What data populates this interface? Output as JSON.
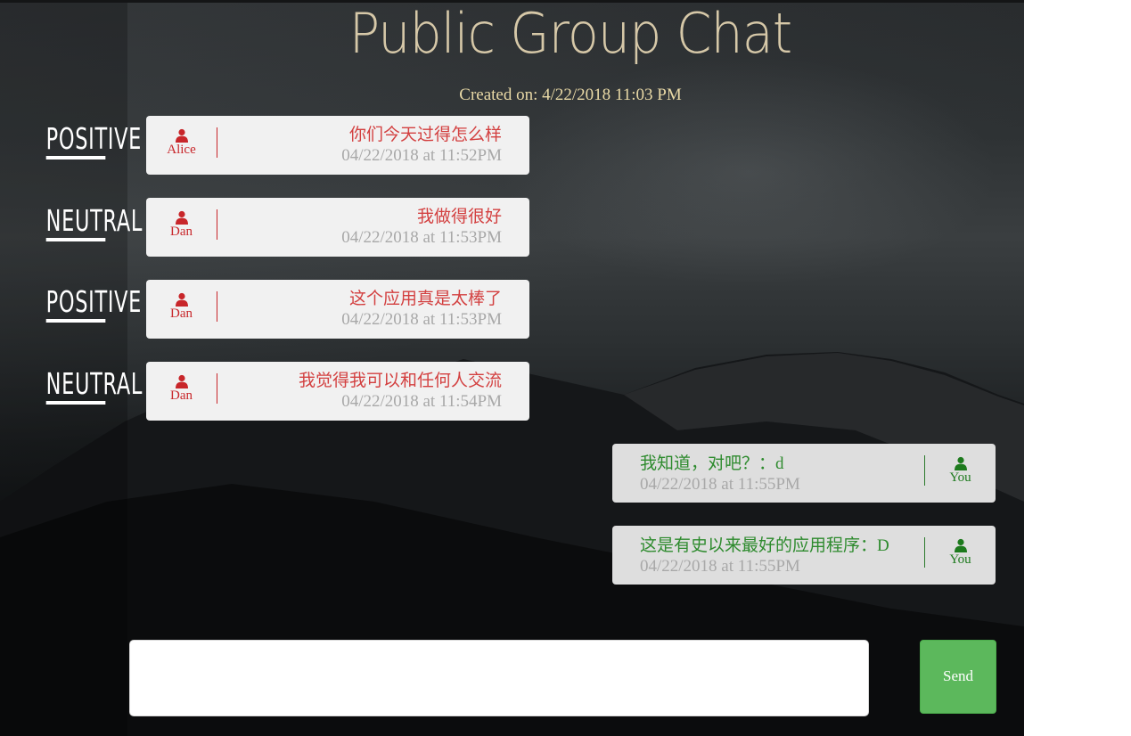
{
  "chat": {
    "title": "Public Group Chat",
    "created": "Created on: 4/22/2018 11:03 PM"
  },
  "sentiments": [
    "POSITIVE",
    "NEUTRAL",
    "POSITIVE",
    "NEUTRAL"
  ],
  "messages": [
    {
      "author": "Alice",
      "text": "你们今天过得怎么样",
      "time": "04/22/2018 at 11:52PM",
      "side": "in"
    },
    {
      "author": "Dan",
      "text": "我做得很好",
      "time": "04/22/2018 at 11:53PM",
      "side": "in"
    },
    {
      "author": "Dan",
      "text": "这个应用真是太棒了",
      "time": "04/22/2018 at 11:53PM",
      "side": "in"
    },
    {
      "author": "Dan",
      "text": "我觉得我可以和任何人交流",
      "time": "04/22/2018 at 11:54PM",
      "side": "in"
    },
    {
      "author": "You",
      "text": "我知道，对吧？：d",
      "time": "04/22/2018 at 11:55PM",
      "side": "out"
    },
    {
      "author": "You",
      "text": "这是有史以来最好的应用程序：D",
      "time": "04/22/2018 at 11:55PM",
      "side": "out"
    }
  ],
  "composer": {
    "value": "",
    "send_label": "Send"
  },
  "colors": {
    "incoming_author": "#c8262a",
    "outgoing_author": "#1d7a1d",
    "send_button": "#5cb85c",
    "title": "#d6c8a8"
  },
  "icons": {
    "author": "person-icon"
  }
}
